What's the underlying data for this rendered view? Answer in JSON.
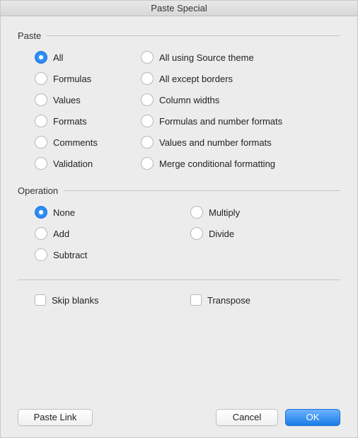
{
  "title": "Paste Special",
  "sections": {
    "paste": {
      "label": "Paste",
      "options": {
        "all": "All",
        "formulas": "Formulas",
        "values": "Values",
        "formats": "Formats",
        "comments": "Comments",
        "validation": "Validation",
        "all_source_theme": "All using Source theme",
        "all_except_borders": "All except borders",
        "column_widths": "Column widths",
        "formulas_number_formats": "Formulas and number formats",
        "values_number_formats": "Values and number formats",
        "merge_conditional": "Merge conditional formatting"
      },
      "selected": "all"
    },
    "operation": {
      "label": "Operation",
      "options": {
        "none": "None",
        "add": "Add",
        "subtract": "Subtract",
        "multiply": "Multiply",
        "divide": "Divide"
      },
      "selected": "none"
    }
  },
  "checkboxes": {
    "skip_blanks": "Skip blanks",
    "transpose": "Transpose"
  },
  "buttons": {
    "paste_link": "Paste Link",
    "cancel": "Cancel",
    "ok": "OK"
  }
}
